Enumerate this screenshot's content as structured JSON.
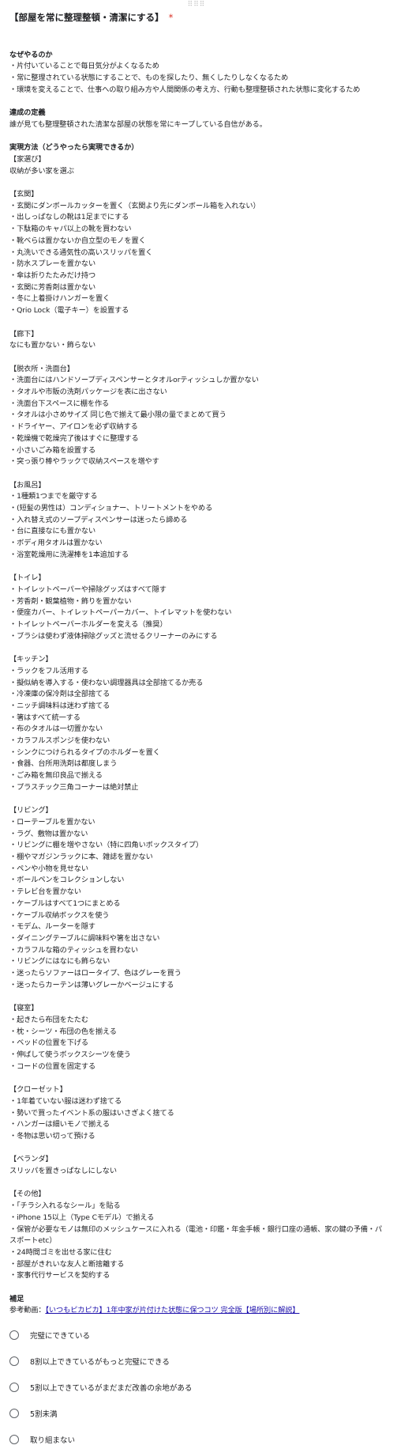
{
  "question": {
    "title": "【部屋を常に整理整頓・清潔にする】",
    "required_mark": "*",
    "drag_handle": "⠿⠿⠿"
  },
  "description_lines": [
    {
      "text": "",
      "style": "blank"
    },
    {
      "text": "なぜやるのか",
      "style": "heading"
    },
    {
      "text": "・片付いていることで毎日気分がよくなるため",
      "style": "normal"
    },
    {
      "text": "・常に整理されている状態にすることで、ものを探したり、無くしたりしなくなるため",
      "style": "normal"
    },
    {
      "text": "・環境を変えることで、仕事への取り組み方や人間関係の考え方、行動も整理整頓された状態に変化するため",
      "style": "normal"
    },
    {
      "text": "",
      "style": "blank"
    },
    {
      "text": "達成の定義",
      "style": "heading"
    },
    {
      "text": "誰が見ても整理整頓された清潔な部屋の状態を常にキープしている自信がある。",
      "style": "normal"
    },
    {
      "text": "",
      "style": "blank"
    },
    {
      "text": "実現方法（どうやったら実現できるか）",
      "style": "heading"
    },
    {
      "text": "【家選び】",
      "style": "normal"
    },
    {
      "text": "収納が多い家を選ぶ",
      "style": "normal"
    },
    {
      "text": "",
      "style": "blank"
    },
    {
      "text": "【玄関】",
      "style": "normal"
    },
    {
      "text": "・玄関にダンボールカッターを置く（玄関より先にダンボール箱を入れない）",
      "style": "normal"
    },
    {
      "text": "・出しっぱなしの靴は1足までにする",
      "style": "normal"
    },
    {
      "text": "・下駄箱のキャパ以上の靴を買わない",
      "style": "normal"
    },
    {
      "text": "・靴べらは置かないか自立型のモノを置く",
      "style": "normal"
    },
    {
      "text": "・丸洗いできる通気性の高いスリッパを置く",
      "style": "normal"
    },
    {
      "text": "・防水スプレーを置かない",
      "style": "normal"
    },
    {
      "text": "・傘は折りたたみだけ持つ",
      "style": "normal"
    },
    {
      "text": "・玄関に芳香剤は置かない",
      "style": "normal"
    },
    {
      "text": "・冬に上着掛けハンガーを置く",
      "style": "normal"
    },
    {
      "text": "・Qrio Lock（電子キー）を設置する",
      "style": "normal"
    },
    {
      "text": "",
      "style": "blank"
    },
    {
      "text": "【廊下】",
      "style": "normal"
    },
    {
      "text": "なにも置かない・飾らない",
      "style": "normal"
    },
    {
      "text": "",
      "style": "blank"
    },
    {
      "text": "【脱衣所・洗面台】",
      "style": "normal"
    },
    {
      "text": "・洗面台にはハンドソープディスペンサーとタオルorティッシュしか置かない",
      "style": "normal"
    },
    {
      "text": "・タオルや市販の洗剤パッケージを表に出さない",
      "style": "normal"
    },
    {
      "text": "・洗面台下スペースに棚を作る",
      "style": "normal"
    },
    {
      "text": "・タオルは小さめサイズ 同じ色で揃えて最小限の量でまとめて買う",
      "style": "normal"
    },
    {
      "text": "・ドライヤー、アイロンを必ず収納する",
      "style": "normal"
    },
    {
      "text": "・乾燥機で乾燥完了後はすぐに整理する",
      "style": "normal"
    },
    {
      "text": "・小さいごみ箱を設置する",
      "style": "normal"
    },
    {
      "text": "・突っ張り棒やラックで収納スペースを増やす",
      "style": "normal"
    },
    {
      "text": "",
      "style": "blank"
    },
    {
      "text": "【お風呂】",
      "style": "normal"
    },
    {
      "text": "・1種類1つまでを厳守する",
      "style": "normal"
    },
    {
      "text": "・(短髪の男性は）コンディショナー、トリートメントをやめる",
      "style": "normal"
    },
    {
      "text": "・入れ替え式のソープディスペンサーは迷ったら諦める",
      "style": "normal"
    },
    {
      "text": "・台に直接なにも置かない",
      "style": "normal"
    },
    {
      "text": "・ボディ用タオルは置かない",
      "style": "normal"
    },
    {
      "text": "・浴室乾燥用に洗濯棒を1本追加する",
      "style": "normal"
    },
    {
      "text": "",
      "style": "blank"
    },
    {
      "text": "【トイレ】",
      "style": "normal"
    },
    {
      "text": "・トイレットペーパーや掃除グッズはすべて隠す",
      "style": "normal"
    },
    {
      "text": "・芳香剤・観葉植物・飾りを置かない",
      "style": "normal"
    },
    {
      "text": "・便座カバー、トイレットペーパーカバー、トイレマットを使わない",
      "style": "normal"
    },
    {
      "text": "・トイレットペーパーホルダーを変える（推奨）",
      "style": "normal"
    },
    {
      "text": "・ブラシは使わず液体掃除グッズと流せるクリーナーのみにする",
      "style": "normal"
    },
    {
      "text": "",
      "style": "blank"
    },
    {
      "text": "【キッチン】",
      "style": "normal"
    },
    {
      "text": "・ラックをフル活用する",
      "style": "normal"
    },
    {
      "text": "・擬似納を導入する・使わない調理器具は全部捨てるか売る",
      "style": "normal"
    },
    {
      "text": "・冷凍庫の保冷剤は全部捨てる",
      "style": "normal"
    },
    {
      "text": "・ニッチ調味料は迷わず捨てる",
      "style": "normal"
    },
    {
      "text": "・箸はすべて統一する",
      "style": "normal"
    },
    {
      "text": "・布のタオルは一切置かない",
      "style": "normal"
    },
    {
      "text": "・カラフルスポンジを使わない",
      "style": "normal"
    },
    {
      "text": "・シンクにつけられるタイプのホルダーを置く",
      "style": "normal"
    },
    {
      "text": "・食器、台所用洗剤は都度しまう",
      "style": "normal"
    },
    {
      "text": "・ごみ箱を無印良品で揃える",
      "style": "normal"
    },
    {
      "text": "・プラスチック三角コーナーは絶対禁止",
      "style": "normal"
    },
    {
      "text": "",
      "style": "blank"
    },
    {
      "text": "【リビング】",
      "style": "normal"
    },
    {
      "text": "・ローテーブルを置かない",
      "style": "normal"
    },
    {
      "text": "・ラグ、敷物は置かない",
      "style": "normal"
    },
    {
      "text": "・リビングに棚を増やさない（特に四角いボックスタイプ）",
      "style": "normal"
    },
    {
      "text": "・棚やマガジンラックに本、雑誌を置かない",
      "style": "normal"
    },
    {
      "text": "・ペンや小物を見せない",
      "style": "normal"
    },
    {
      "text": "・ボールペンをコレクションしない",
      "style": "normal"
    },
    {
      "text": "・テレビ台を置かない",
      "style": "normal"
    },
    {
      "text": "・ケーブルはすべて1つにまとめる",
      "style": "normal"
    },
    {
      "text": "・ケーブル収納ボックスを使う",
      "style": "normal"
    },
    {
      "text": "・モデム、ルーターを隠す",
      "style": "normal"
    },
    {
      "text": "・ダイニングテーブルに調味料や箸を出さない",
      "style": "normal"
    },
    {
      "text": "・カラフルな箱のティッシュを買わない",
      "style": "normal"
    },
    {
      "text": "・リビングにはなにも飾らない",
      "style": "normal"
    },
    {
      "text": "・迷ったらソファーはロータイプ、色はグレーを買う",
      "style": "normal"
    },
    {
      "text": "・迷ったらカーテンは薄いグレーかベージュにする",
      "style": "normal"
    },
    {
      "text": "",
      "style": "blank"
    },
    {
      "text": "【寝室】",
      "style": "normal"
    },
    {
      "text": "・起きたら布団をたたむ",
      "style": "normal"
    },
    {
      "text": "・枕・シーツ・布団の色を揃える",
      "style": "normal"
    },
    {
      "text": "・ベッドの位置を下げる",
      "style": "normal"
    },
    {
      "text": "・伸ばして使うボックスシーツを使う",
      "style": "normal"
    },
    {
      "text": "・コードの位置を固定する",
      "style": "normal"
    },
    {
      "text": "",
      "style": "blank"
    },
    {
      "text": "【クローゼット】",
      "style": "normal"
    },
    {
      "text": "・1年着ていない服は迷わず捨てる",
      "style": "normal"
    },
    {
      "text": "・勢いで買ったイベント系の服はいさぎよく捨てる",
      "style": "normal"
    },
    {
      "text": "・ハンガーは細いモノで揃える",
      "style": "normal"
    },
    {
      "text": "・冬物は思い切って預ける",
      "style": "normal"
    },
    {
      "text": "",
      "style": "blank"
    },
    {
      "text": "【ベランダ】",
      "style": "normal"
    },
    {
      "text": "スリッパを置きっぱなしにしない",
      "style": "normal"
    },
    {
      "text": "",
      "style": "blank"
    },
    {
      "text": "【その他】",
      "style": "normal"
    },
    {
      "text": "・「チラシ入れるなシール」を貼る",
      "style": "normal"
    },
    {
      "text": "・iPhone 15以上（Type Cモデル）で揃える",
      "style": "normal"
    },
    {
      "text": "・保管が必要なモノは無印のメッシュケースに入れる（電池・印鑑・年金手帳・銀行口座の通帳、家の鍵の予備・パスポートetc）",
      "style": "wrap"
    },
    {
      "text": "・24時間ゴミを出せる家に住む",
      "style": "normal"
    },
    {
      "text": "・部屋がきれいな友人と断捨離する",
      "style": "normal"
    },
    {
      "text": "・家事代行サービスを契約する",
      "style": "normal"
    },
    {
      "text": "",
      "style": "blank"
    },
    {
      "text": "補足",
      "style": "heading"
    }
  ],
  "reference": {
    "prefix": "参考動画：",
    "link_text": "【いつもピカピカ】1年中家が片付けた状態に保つコツ 完全版【場所別に解説】"
  },
  "options": [
    {
      "label": "完璧にできている"
    },
    {
      "label": "8割以上できているがもっと完璧にできる"
    },
    {
      "label": "5割以上できているがまだまだ改善の余地がある"
    },
    {
      "label": "5割未満"
    },
    {
      "label": "取り組まない"
    }
  ]
}
